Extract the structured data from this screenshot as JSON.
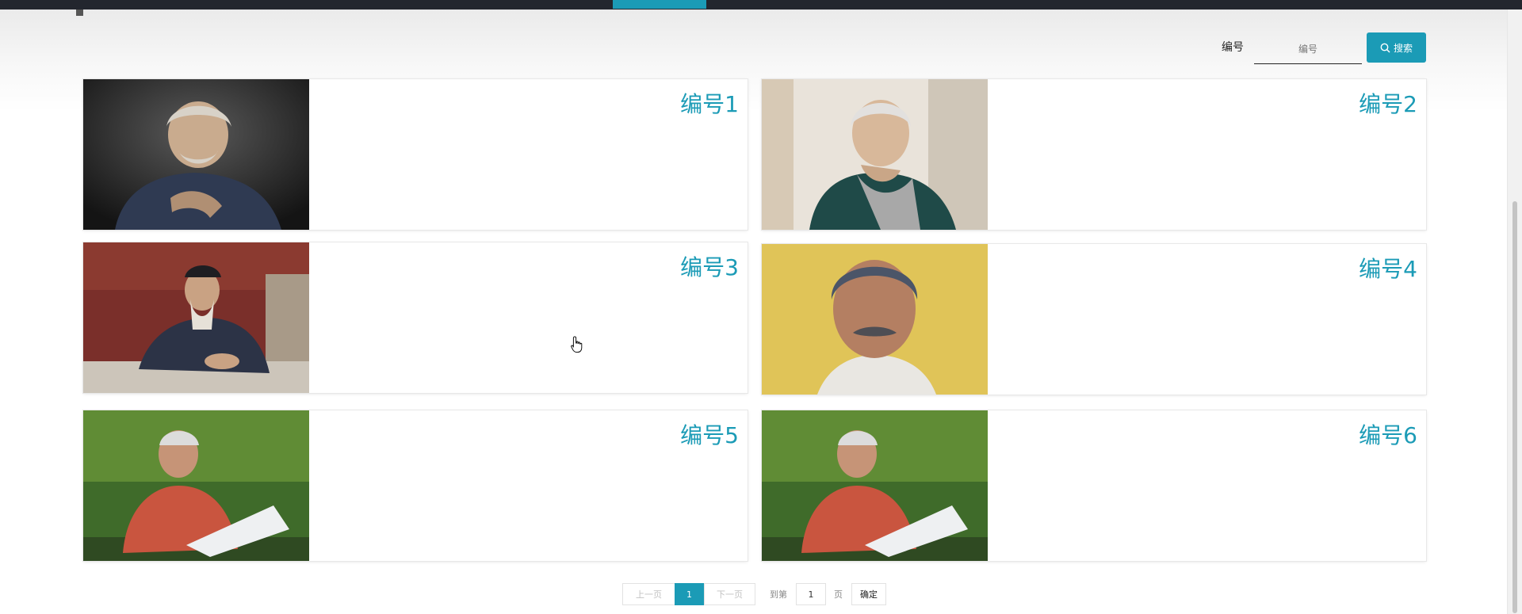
{
  "search": {
    "label": "编号",
    "placeholder": "编号",
    "button_label": "搜索"
  },
  "cards": [
    {
      "title": "编号1",
      "photo": "elderly-man-portrait"
    },
    {
      "title": "编号2",
      "photo": "elderly-woman-smiling"
    },
    {
      "title": "编号3",
      "photo": "elderly-man-writing"
    },
    {
      "title": "编号4",
      "photo": "elderly-man-mustache"
    },
    {
      "title": "编号5",
      "photo": "elderly-man-reading-newspaper"
    },
    {
      "title": "编号6",
      "photo": "elderly-man-reading-newspaper"
    }
  ],
  "pagination": {
    "prev_label": "上一页",
    "current_page": "1",
    "next_label": "下一页",
    "goto_label": "到第",
    "goto_value": "1",
    "page_unit": "页",
    "confirm_label": "确定"
  },
  "colors": {
    "accent": "#1b9bb6",
    "nav_bg": "#23262e"
  },
  "icons": {
    "search_button": "search-icon",
    "cursor": "hand-pointer-icon"
  }
}
